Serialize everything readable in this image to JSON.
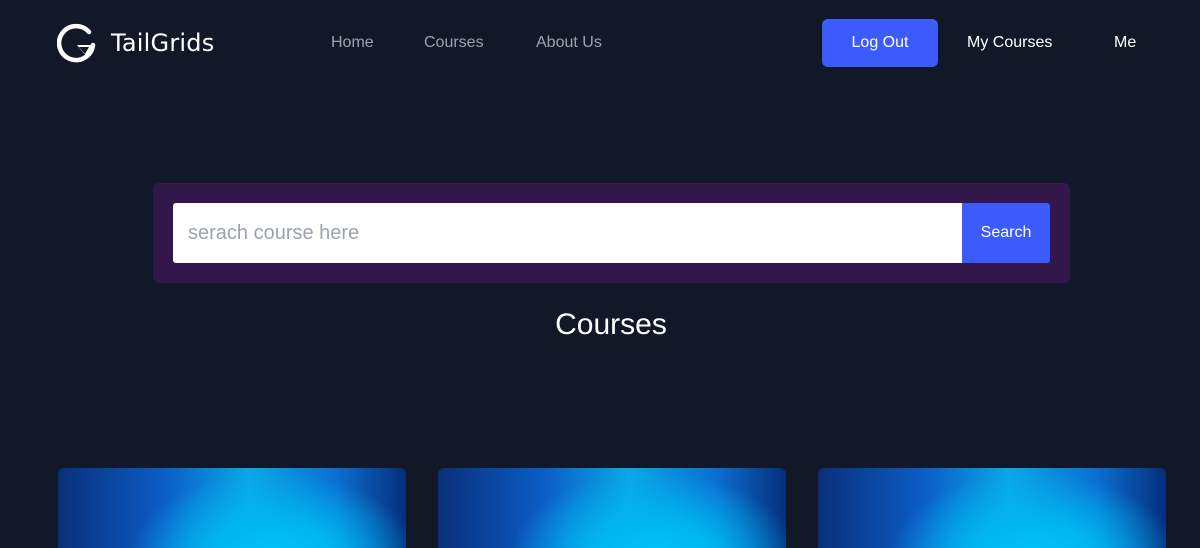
{
  "brand": {
    "name": "TailGrids"
  },
  "nav": {
    "links": [
      "Home",
      "Courses",
      "About Us"
    ],
    "logout_label": "Log Out",
    "my_courses_label": "My Courses",
    "me_label": "Me"
  },
  "search": {
    "placeholder": "serach course here",
    "value": "",
    "button_label": "Search"
  },
  "main": {
    "title": "Courses"
  },
  "colors": {
    "background": "#111827",
    "accent": "#3b5bfd",
    "search_panel": "#33164a",
    "nav_link": "#9ca3af"
  }
}
